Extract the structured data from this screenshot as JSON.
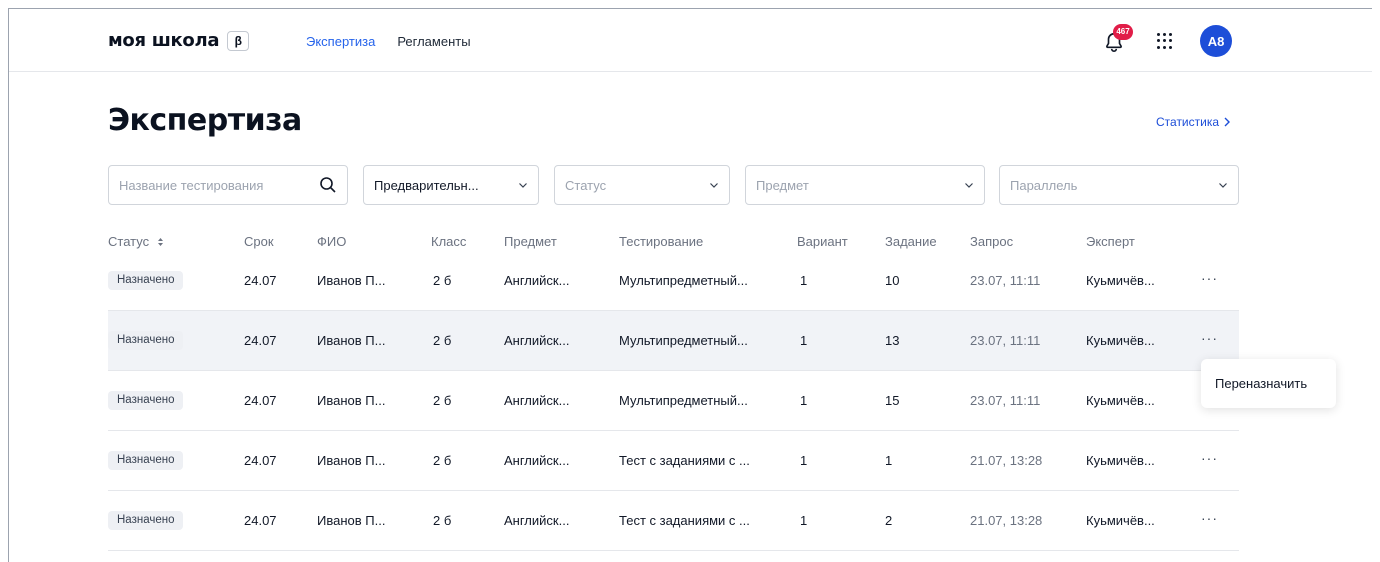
{
  "header": {
    "logo": "моя школа",
    "beta": "β",
    "nav": [
      {
        "label": "Экспертиза",
        "active": true
      },
      {
        "label": "Регламенты",
        "active": false
      }
    ],
    "notifications_count": "467",
    "avatar_initials": "А8"
  },
  "page": {
    "title": "Экспертиза",
    "stats_link": "Статистика"
  },
  "filters": {
    "search_placeholder": "Название тестирования",
    "type_value": "Предварительн...",
    "status_placeholder": "Статус",
    "subject_placeholder": "Предмет",
    "parallel_placeholder": "Параллель"
  },
  "table": {
    "columns": [
      "Статус",
      "Срок",
      "ФИО",
      "Класс",
      "Предмет",
      "Тестирование",
      "Вариант",
      "Задание",
      "Запрос",
      "Эксперт"
    ],
    "rows": [
      {
        "status": "Назначено",
        "due": "24.07",
        "name": "Иванов П...",
        "class": "2 б",
        "subject": "Английск...",
        "test": "Мультипредметный...",
        "variant": "1",
        "task": "10",
        "request": "23.07, 11:11",
        "expert": "Куьмичёв..."
      },
      {
        "status": "Назначено",
        "due": "24.07",
        "name": "Иванов П...",
        "class": "2 б",
        "subject": "Английск...",
        "test": "Мультипредметный...",
        "variant": "1",
        "task": "13",
        "request": "23.07, 11:11",
        "expert": "Куьмичёв..."
      },
      {
        "status": "Назначено",
        "due": "24.07",
        "name": "Иванов П...",
        "class": "2 б",
        "subject": "Английск...",
        "test": "Мультипредметный...",
        "variant": "1",
        "task": "15",
        "request": "23.07, 11:11",
        "expert": "Куьмичёв..."
      },
      {
        "status": "Назначено",
        "due": "24.07",
        "name": "Иванов П...",
        "class": "2 б",
        "subject": "Английск...",
        "test": "Тест с заданиями с ...",
        "variant": "1",
        "task": "1",
        "request": "21.07, 13:28",
        "expert": "Куьмичёв..."
      },
      {
        "status": "Назначено",
        "due": "24.07",
        "name": "Иванов П...",
        "class": "2 б",
        "subject": "Английск...",
        "test": "Тест с заданиями с ...",
        "variant": "1",
        "task": "2",
        "request": "21.07, 13:28",
        "expert": "Куьмичёв..."
      }
    ]
  },
  "context_menu": {
    "reassign": "Переназначить"
  },
  "colors": {
    "accent": "#1d4ed8",
    "badge": "#e11d48",
    "row_highlight": "#f1f3f7"
  }
}
